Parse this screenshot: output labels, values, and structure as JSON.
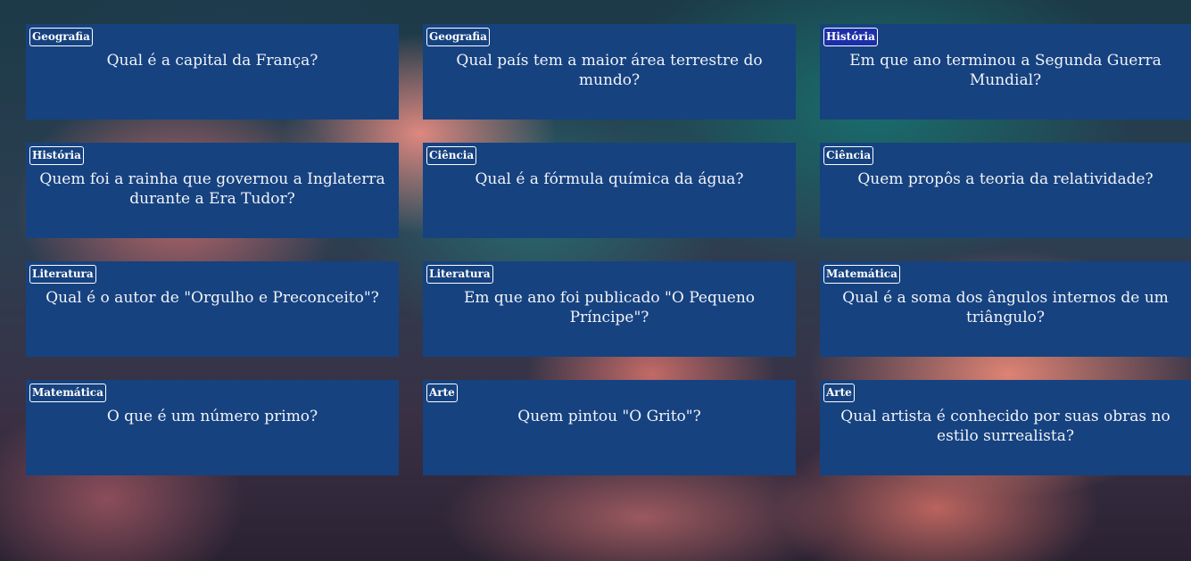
{
  "cards": [
    {
      "category": "Geografia",
      "question": "Qual é a capital da França?"
    },
    {
      "category": "Geografia",
      "question": "Qual país tem a maior área terrestre do mundo?"
    },
    {
      "category": "História",
      "question": "Em que ano terminou a Segunda Guerra Mundial?"
    },
    {
      "category": "História",
      "question": "Quem foi a rainha que governou a Inglaterra durante a Era Tudor?"
    },
    {
      "category": "Ciência",
      "question": "Qual é a fórmula química da água?"
    },
    {
      "category": "Ciência",
      "question": "Quem propôs a teoria da relatividade?"
    },
    {
      "category": "Literatura",
      "question": "Qual é o autor de \"Orgulho e Preconceito\"?"
    },
    {
      "category": "Literatura",
      "question": "Em que ano foi publicado \"O Pequeno Príncipe\"?"
    },
    {
      "category": "Matemática",
      "question": "Qual é a soma dos ângulos internos de um triângulo?"
    },
    {
      "category": "Matemática",
      "question": "O que é um número primo?"
    },
    {
      "category": "Arte",
      "question": "Quem pintou \"O Grito\"?"
    },
    {
      "category": "Arte",
      "question": "Qual artista é conhecido por suas obras no estilo surrealista?"
    }
  ],
  "colors": {
    "card_background": "#164280",
    "card_text": "#f1f3f8",
    "badge_border": "#ffffff",
    "badge_highlight": "#1b2fa8"
  }
}
